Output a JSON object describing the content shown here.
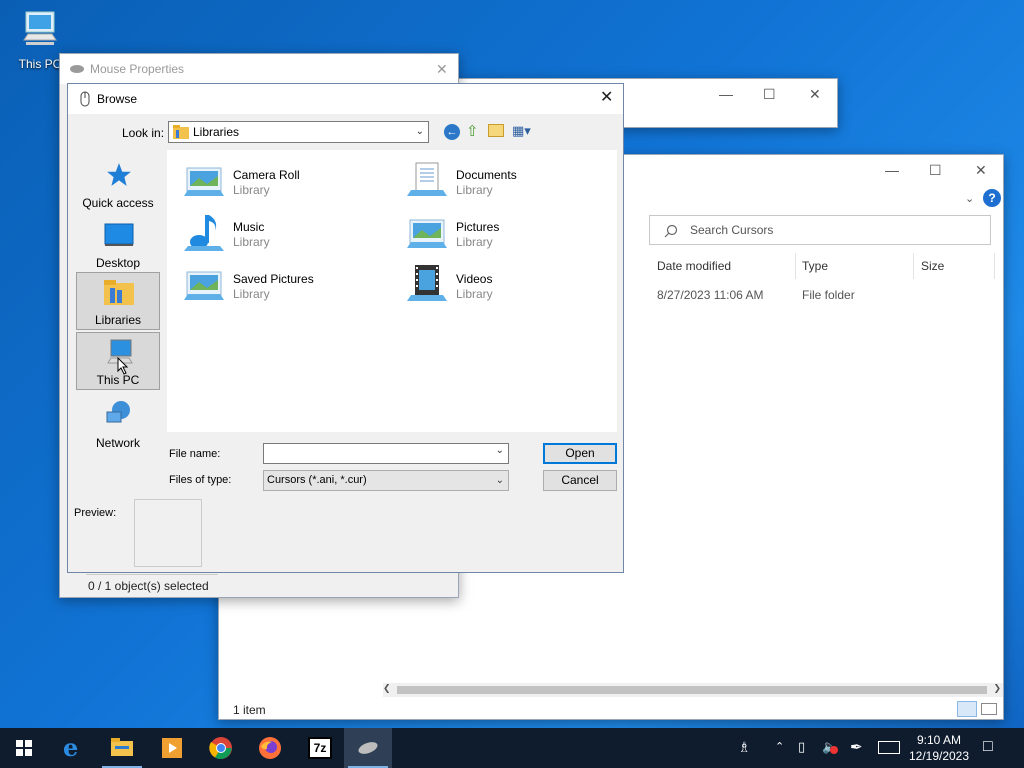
{
  "desktop": {
    "icons": [
      {
        "label": "This PC",
        "icon": "computer-icon"
      }
    ]
  },
  "mouse_properties": {
    "title": "Mouse Properties",
    "status": "0 / 1 object(s) selected"
  },
  "explorer": {
    "search_placeholder": "Search Cursors",
    "columns": [
      "Date modified",
      "Type",
      "Size"
    ],
    "rows": [
      {
        "date_modified": "8/27/2023 11:06 AM",
        "type": "File folder"
      }
    ],
    "status": "1 item"
  },
  "browse": {
    "title": "Browse",
    "look_in_label": "Look in:",
    "look_in_value": "Libraries",
    "places": [
      {
        "label": "Quick access",
        "icon": "star-icon",
        "selected": false
      },
      {
        "label": "Desktop",
        "icon": "desktop-icon",
        "selected": false
      },
      {
        "label": "Libraries",
        "icon": "libraries-icon",
        "selected": true
      },
      {
        "label": "This PC",
        "icon": "computer-icon",
        "selected": true
      },
      {
        "label": "Network",
        "icon": "network-icon",
        "selected": false
      }
    ],
    "items": [
      {
        "name": "Camera Roll",
        "type": "Library",
        "icon": "picture-library-icon"
      },
      {
        "name": "Documents",
        "type": "Library",
        "icon": "document-icon"
      },
      {
        "name": "Music",
        "type": "Library",
        "icon": "music-icon"
      },
      {
        "name": "Pictures",
        "type": "Library",
        "icon": "picture-library-icon"
      },
      {
        "name": "Saved Pictures",
        "type": "Library",
        "icon": "picture-library-icon"
      },
      {
        "name": "Videos",
        "type": "Library",
        "icon": "video-icon"
      }
    ],
    "file_name_label": "File name:",
    "file_name_value": "",
    "file_type_label": "Files of type:",
    "file_type_value": "Cursors (*.ani, *.cur)",
    "open_label": "Open",
    "cancel_label": "Cancel",
    "preview_label": "Preview:"
  },
  "taskbar": {
    "apps": [
      "start-icon",
      "edge-icon",
      "file-explorer-icon",
      "media-player-icon",
      "chrome-icon",
      "firefox-icon",
      "7zip-icon",
      "mouse-icon"
    ],
    "time": "9:10 AM",
    "date": "12/19/2023"
  },
  "colors": {
    "accent": "#0078d7",
    "taskbar": "#0f1c2e",
    "desktop": "#1174d6"
  }
}
